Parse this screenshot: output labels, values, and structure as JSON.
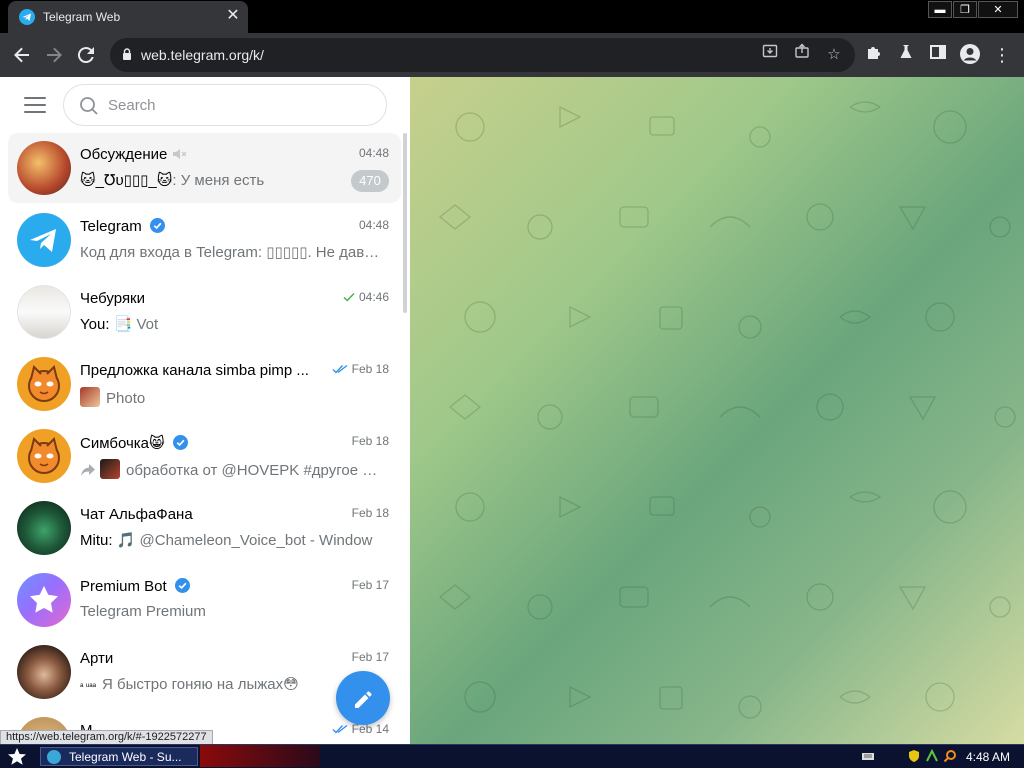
{
  "browser": {
    "tab_title": "Telegram Web",
    "url": "web.telegram.org/k/",
    "status_url": "https://web.telegram.org/k/#-1922572277",
    "window_controls": {
      "minimize": "▬",
      "maximize": "❐",
      "close": "✕"
    }
  },
  "telegram": {
    "search_placeholder": "Search",
    "chats": [
      {
        "name": "Обсуждение",
        "time": "04:48",
        "sender": "🐱_℧υ▯▯▯_🐱",
        "message": ": У меня есть",
        "unread": "470",
        "muted": true,
        "active": true
      },
      {
        "name": "Telegram",
        "time": "04:48",
        "message": "Код для входа в Telegram: ▯▯▯▯▯. Не давайте",
        "verified": true
      },
      {
        "name": "Чебуряки",
        "time": "04:46",
        "sender": "You: ",
        "message": "📑 Vot",
        "status": "sent"
      },
      {
        "name": "Предложка канала simba pimp ...",
        "time": "Feb 18",
        "message": "Photo",
        "status": "read"
      },
      {
        "name": "Симбочка😸",
        "time": "Feb 18",
        "message": "обработка от @HOVEPK #другое #прочее",
        "verified": true,
        "forwarded": true
      },
      {
        "name": "Чат АльфаФана",
        "time": "Feb 18",
        "sender": "Mitu: ",
        "message": "🎵 @Chameleon_Voice_bot - Window",
        "status": ""
      },
      {
        "name": "Premium Bot",
        "time": "Feb 17",
        "message": "Telegram Premium",
        "verified": true
      },
      {
        "name": "Арти",
        "time": "Feb 17",
        "message": "Я быстро гоняю на лыжах😳",
        "prefix": "ᵃ ᵘᵃᵃ"
      },
      {
        "name": "М",
        "time": "Feb 14",
        "message": "",
        "status": "read"
      }
    ]
  },
  "taskbar": {
    "task_label": "Telegram Web - Su...",
    "clock": "4:48 AM"
  },
  "colors": {
    "accent": "#3390ec",
    "verified": "#3390ec",
    "read_check": "#4fae4e",
    "wallpaper_start": "#c7d08c",
    "wallpaper_end": "#6aa57c"
  }
}
